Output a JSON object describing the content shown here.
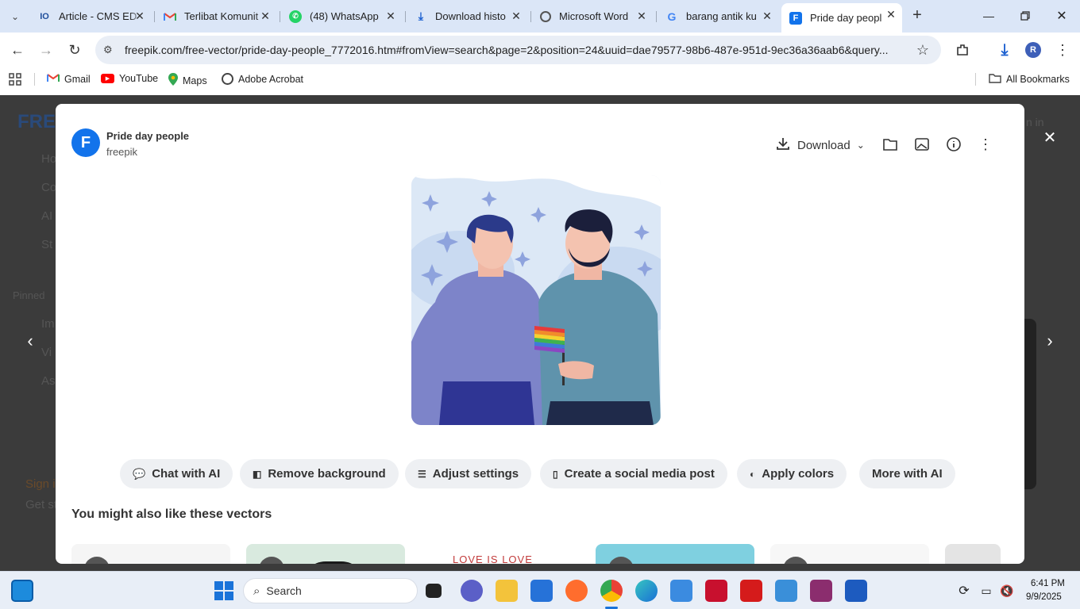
{
  "tabs": [
    {
      "title": "Article - CMS ED",
      "icon": "cms-favicon"
    },
    {
      "title": "Terlibat Komunit",
      "icon": "gmail-favicon"
    },
    {
      "title": "(48) WhatsApp",
      "icon": "whatsapp-favicon"
    },
    {
      "title": "Download histo",
      "icon": "download-favicon"
    },
    {
      "title": "Microsoft Word",
      "icon": "globe-favicon"
    },
    {
      "title": "barang antik ku",
      "icon": "google-favicon"
    },
    {
      "title": "Pride day peopl",
      "icon": "freepik-favicon"
    }
  ],
  "address": {
    "url": "freepik.com/free-vector/pride-day-people_7772016.htm#fromView=search&page=2&position=24&uuid=dae79577-98b6-487e-951d-9ec36a36aab6&query..."
  },
  "bookmarks": [
    {
      "label": "Gmail",
      "icon": "gmail-icon"
    },
    {
      "label": "YouTube",
      "icon": "youtube-icon"
    },
    {
      "label": "Maps",
      "icon": "maps-icon"
    },
    {
      "label": "Adobe Acrobat",
      "icon": "acrobat-icon"
    }
  ],
  "all_bookmarks": "All Bookmarks",
  "background": {
    "logo": "FRE",
    "side": [
      "Ho",
      "Co",
      "AI",
      "St"
    ],
    "pinned": "Pinned",
    "side2": [
      "Im",
      "Vi",
      "As"
    ],
    "sign": "Sign i",
    "get": "Get st",
    "top_right": "n in"
  },
  "modal": {
    "title": "Pride day people",
    "author": "freepik",
    "download_label": "Download",
    "ai_buttons": [
      "Chat with AI",
      "Remove background",
      "Adjust settings",
      "Create a social media post",
      "Apply colors",
      "More with AI"
    ],
    "section_title": "You might also like these vectors",
    "thumb_text": "LOVE IS LOVE"
  },
  "taskbar": {
    "search": "Search",
    "time": "6:41 PM",
    "date": "9/9/2025"
  },
  "colors": {
    "tabbar": "#dbe6f7",
    "accent": "#1273eb",
    "overlay": "#3b3b3b"
  }
}
